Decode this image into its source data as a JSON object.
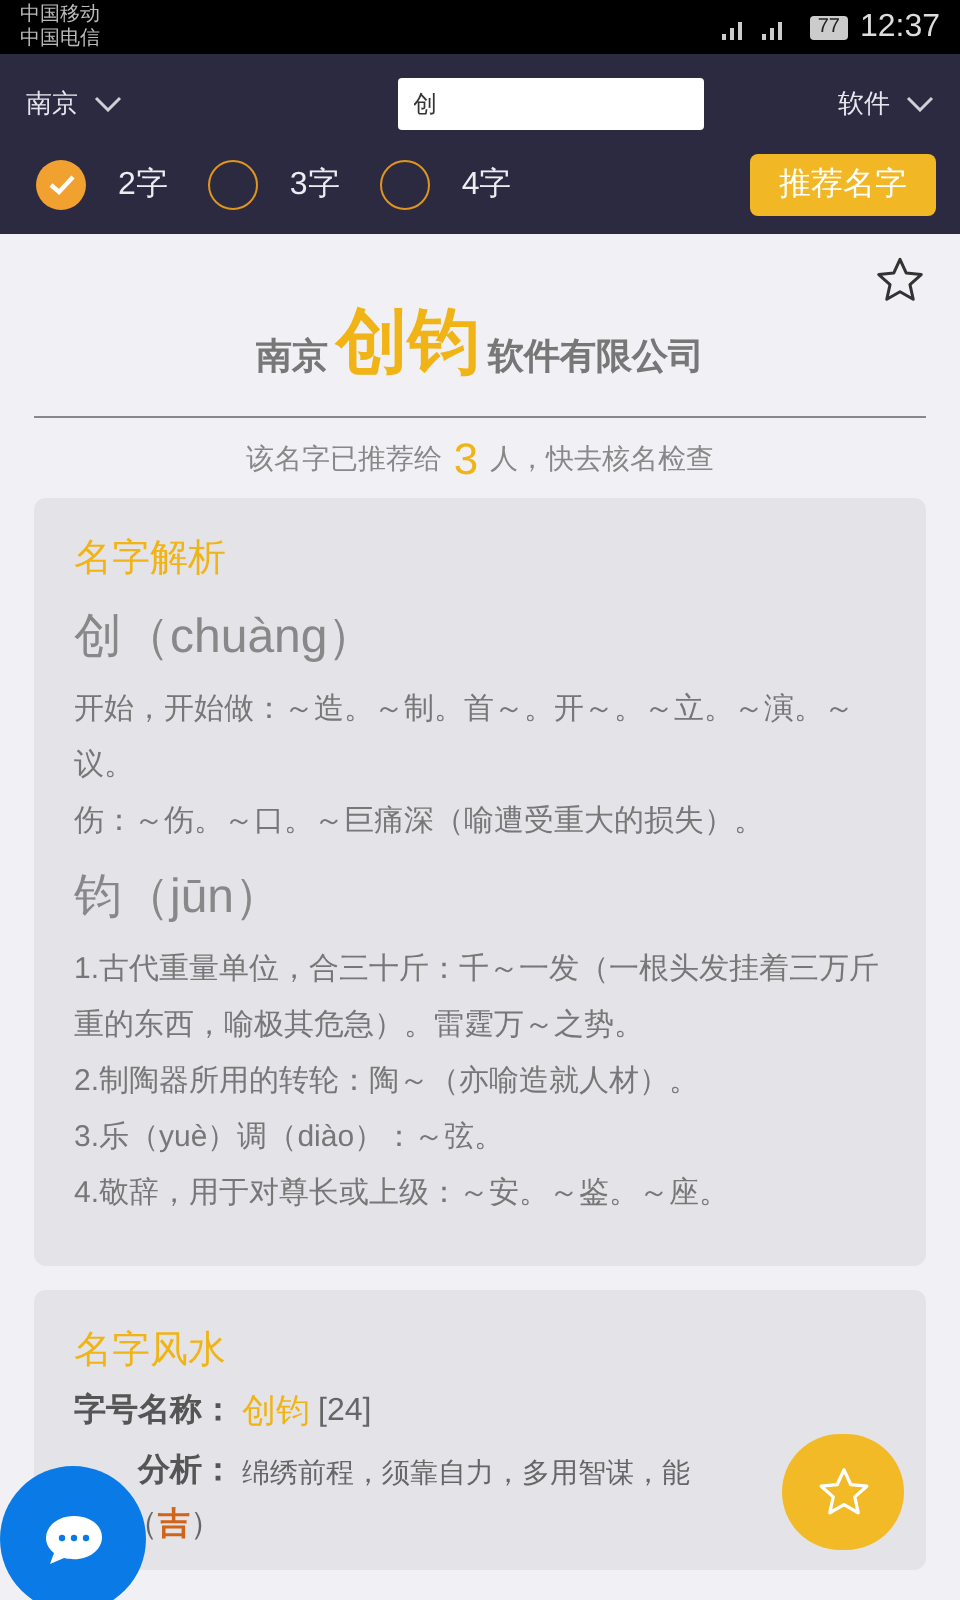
{
  "status_bar": {
    "carriers": [
      "中国移动",
      "中国电信"
    ],
    "battery": "77",
    "time": "12:37"
  },
  "header": {
    "city": "南京",
    "search": {
      "value": "创"
    },
    "industry": "软件",
    "lengths": [
      {
        "label": "2字",
        "selected": true
      },
      {
        "label": "3字",
        "selected": false
      },
      {
        "label": "4字",
        "selected": false
      }
    ],
    "recommend_button": "推荐名字"
  },
  "result": {
    "favorite": false,
    "prefix": "南京",
    "name": "创钧",
    "suffix": "软件有限公司",
    "count_text_before": "该名字已推荐给",
    "count": "3",
    "count_text_after": "人，快去核名检查"
  },
  "analysis": {
    "title": "名字解析",
    "chars": [
      {
        "heading": "创（chuàng）",
        "lines": [
          "开始，开始做：～造。～制。首～。开～。～立。～演。～议。",
          "伤：～伤。～口。～巨痛深（喻遭受重大的损失）。"
        ]
      },
      {
        "heading": "钧（jūn）",
        "lines": [
          "1.古代重量单位，合三十斤：千～一发（一根头发挂着三万斤重的东西，喻极其危急）。雷霆万～之势。",
          "2.制陶器所用的转轮：陶～（亦喻造就人材）。",
          "3.乐（yuè）调（diào）：～弦。",
          "4.敬辞，用于对尊长或上级：～安。～鉴。～座。"
        ]
      }
    ]
  },
  "fengshui": {
    "title": "名字风水",
    "name_label": "字号名称：",
    "name_value": "创钧",
    "name_score": "[24]",
    "analysis_label": "分析：",
    "analysis_value": "绵绣前程，须靠自力，多用智谋，能",
    "luck_open": "（",
    "luck": "吉",
    "luck_close": "）"
  }
}
